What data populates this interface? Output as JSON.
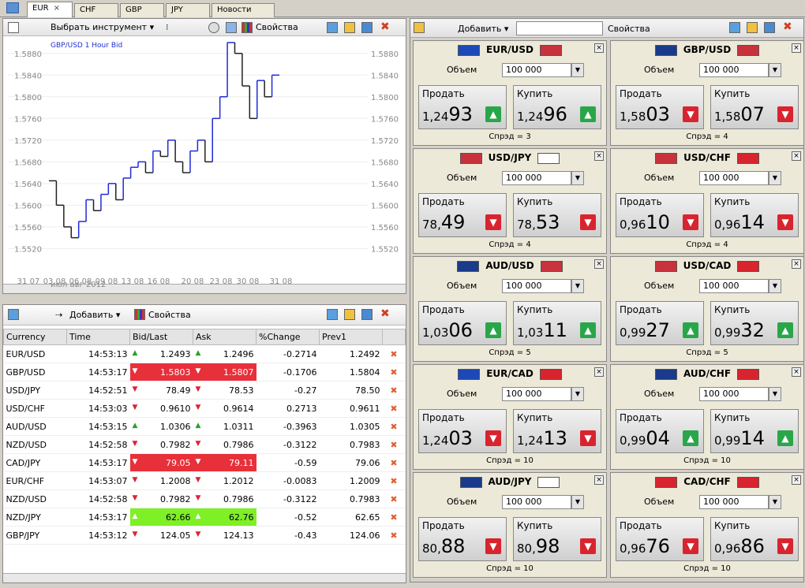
{
  "tabs": [
    {
      "label": "EUR",
      "active": true,
      "close": "×"
    },
    {
      "label": "CHF"
    },
    {
      "label": "GBP"
    },
    {
      "label": "JPY"
    },
    {
      "label": "Новости"
    }
  ],
  "chart": {
    "toolbar": {
      "instrument_label": "Выбрать инструмент ▾",
      "props_label": "Свойства"
    },
    "title": "GBP/USD 1 Hour Bid",
    "month_label": "июл  авг 2012",
    "chart_data": {
      "type": "line",
      "title": "GBP/USD 1 Hour Bid",
      "yticks": [
        "1.5880",
        "1.5840",
        "1.5800",
        "1.5760",
        "1.5720",
        "1.5680",
        "1.5640",
        "1.5600",
        "1.5560",
        "1.5520"
      ],
      "ylim": [
        1.549,
        1.59
      ],
      "xticks": [
        "31 07",
        "03 08",
        "06 08",
        "09 08",
        "13 08",
        "16 08",
        "20 08",
        "23 08",
        "30 08",
        "31 08"
      ],
      "series": [
        {
          "values": [
            1.5645,
            1.56,
            1.556,
            1.554,
            1.557,
            1.561,
            1.559,
            1.562,
            1.564,
            1.561,
            1.565,
            1.567,
            1.568,
            1.566,
            1.57,
            1.569,
            1.572,
            1.568,
            1.566,
            1.57,
            1.572,
            1.568,
            1.576,
            1.58,
            1.59,
            1.588,
            1.582,
            1.576,
            1.583,
            1.58,
            1.584
          ]
        }
      ]
    }
  },
  "quotes": {
    "toolbar": {
      "add_label": "Добавить ▾",
      "props_label": "Свойства"
    },
    "columns": [
      "Currency",
      "Time",
      "Bid/Last",
      "Ask",
      "%Change",
      "Prev1"
    ],
    "rows": [
      {
        "cur": "EUR/USD",
        "time": "14:53:13",
        "bid": "1.2493",
        "ask": "1.2496",
        "chg": "-0.2714",
        "prev": "1.2492",
        "dir": "up"
      },
      {
        "cur": "GBP/USD",
        "time": "14:53:17",
        "bid": "1.5803",
        "ask": "1.5807",
        "chg": "-0.1706",
        "prev": "1.5804",
        "dir": "redbg"
      },
      {
        "cur": "USD/JPY",
        "time": "14:52:51",
        "bid": "78.49",
        "ask": "78.53",
        "chg": "-0.27",
        "prev": "78.50",
        "dir": "dn"
      },
      {
        "cur": "USD/CHF",
        "time": "14:53:03",
        "bid": "0.9610",
        "ask": "0.9614",
        "chg": "0.2713",
        "prev": "0.9611",
        "dir": "dn"
      },
      {
        "cur": "AUD/USD",
        "time": "14:53:15",
        "bid": "1.0306",
        "ask": "1.0311",
        "chg": "-0.3963",
        "prev": "1.0305",
        "dir": "up"
      },
      {
        "cur": "NZD/USD",
        "time": "14:52:58",
        "bid": "0.7982",
        "ask": "0.7986",
        "chg": "-0.3122",
        "prev": "0.7983",
        "dir": "dn"
      },
      {
        "cur": "CAD/JPY",
        "time": "14:53:17",
        "bid": "79.05",
        "ask": "79.11",
        "chg": "-0.59",
        "prev": "79.06",
        "dir": "redbg"
      },
      {
        "cur": "EUR/CHF",
        "time": "14:53:07",
        "bid": "1.2008",
        "ask": "1.2012",
        "chg": "-0.0083",
        "prev": "1.2009",
        "dir": "dn"
      },
      {
        "cur": "NZD/USD",
        "time": "14:52:58",
        "bid": "0.7982",
        "ask": "0.7986",
        "chg": "-0.3122",
        "prev": "0.7983",
        "dir": "dn"
      },
      {
        "cur": "NZD/JPY",
        "time": "14:53:17",
        "bid": "62.66",
        "ask": "62.76",
        "chg": "-0.52",
        "prev": "62.65",
        "dir": "greenbg"
      },
      {
        "cur": "GBP/JPY",
        "time": "14:53:12",
        "bid": "124.05",
        "ask": "124.13",
        "chg": "-0.43",
        "prev": "124.06",
        "dir": "dn"
      }
    ]
  },
  "deal": {
    "toolbar": {
      "add_label": "Добавить ▾",
      "props_label": "Свойства"
    },
    "vol_label": "Объем",
    "vol_value": "100 000",
    "sell_label": "Продать",
    "buy_label": "Купить",
    "cards": [
      {
        "pair": "EUR/USD",
        "sell_pre": "1,24",
        "sell_big": "93",
        "buy_pre": "1,24",
        "buy_big": "96",
        "sell_dir": "up",
        "buy_dir": "up",
        "spread": "Спрэд = 3",
        "flag1": "#1c49b7",
        "flag2": "#c8323c"
      },
      {
        "pair": "GBP/USD",
        "sell_pre": "1,58",
        "sell_big": "03",
        "buy_pre": "1,58",
        "buy_big": "07",
        "sell_dir": "dn",
        "buy_dir": "dn",
        "spread": "Спрэд = 4",
        "flag1": "#1a3a8a",
        "flag2": "#c8323c"
      },
      {
        "pair": "USD/JPY",
        "sell_pre": "78,",
        "sell_big": "49",
        "buy_pre": "78,",
        "buy_big": "53",
        "sell_dir": "dn",
        "buy_dir": "dn",
        "spread": "Спрэд = 4",
        "flag1": "#c8323c",
        "flag2": "#ffffff"
      },
      {
        "pair": "USD/CHF",
        "sell_pre": "0,96",
        "sell_big": "10",
        "buy_pre": "0,96",
        "buy_big": "14",
        "sell_dir": "dn",
        "buy_dir": "dn",
        "spread": "Спрэд = 4",
        "flag1": "#c8323c",
        "flag2": "#d8242e"
      },
      {
        "pair": "AUD/USD",
        "sell_pre": "1,03",
        "sell_big": "06",
        "buy_pre": "1,03",
        "buy_big": "11",
        "sell_dir": "up",
        "buy_dir": "up",
        "spread": "Спрэд = 5",
        "flag1": "#1a3a8a",
        "flag2": "#c8323c"
      },
      {
        "pair": "USD/CAD",
        "sell_pre": "0,99",
        "sell_big": "27",
        "buy_pre": "0,99",
        "buy_big": "32",
        "sell_dir": "up",
        "buy_dir": "up",
        "spread": "Спрэд = 5",
        "flag1": "#c8323c",
        "flag2": "#d8242e"
      },
      {
        "pair": "EUR/CAD",
        "sell_pre": "1,24",
        "sell_big": "03",
        "buy_pre": "1,24",
        "buy_big": "13",
        "sell_dir": "dn",
        "buy_dir": "dn",
        "spread": "Спрэд = 10",
        "flag1": "#1c49b7",
        "flag2": "#d8242e"
      },
      {
        "pair": "AUD/CHF",
        "sell_pre": "0,99",
        "sell_big": "04",
        "buy_pre": "0,99",
        "buy_big": "14",
        "sell_dir": "up",
        "buy_dir": "up",
        "spread": "Спрэд = 10",
        "flag1": "#1a3a8a",
        "flag2": "#d8242e"
      },
      {
        "pair": "AUD/JPY",
        "sell_pre": "80,",
        "sell_big": "88",
        "buy_pre": "80,",
        "buy_big": "98",
        "sell_dir": "dn",
        "buy_dir": "dn",
        "spread": "Спрэд = 10",
        "flag1": "#1a3a8a",
        "flag2": "#ffffff"
      },
      {
        "pair": "CAD/CHF",
        "sell_pre": "0,96",
        "sell_big": "76",
        "buy_pre": "0,96",
        "buy_big": "86",
        "sell_dir": "dn",
        "buy_dir": "dn",
        "spread": "Спрэд = 10",
        "flag1": "#d8242e",
        "flag2": "#d8242e"
      }
    ]
  }
}
